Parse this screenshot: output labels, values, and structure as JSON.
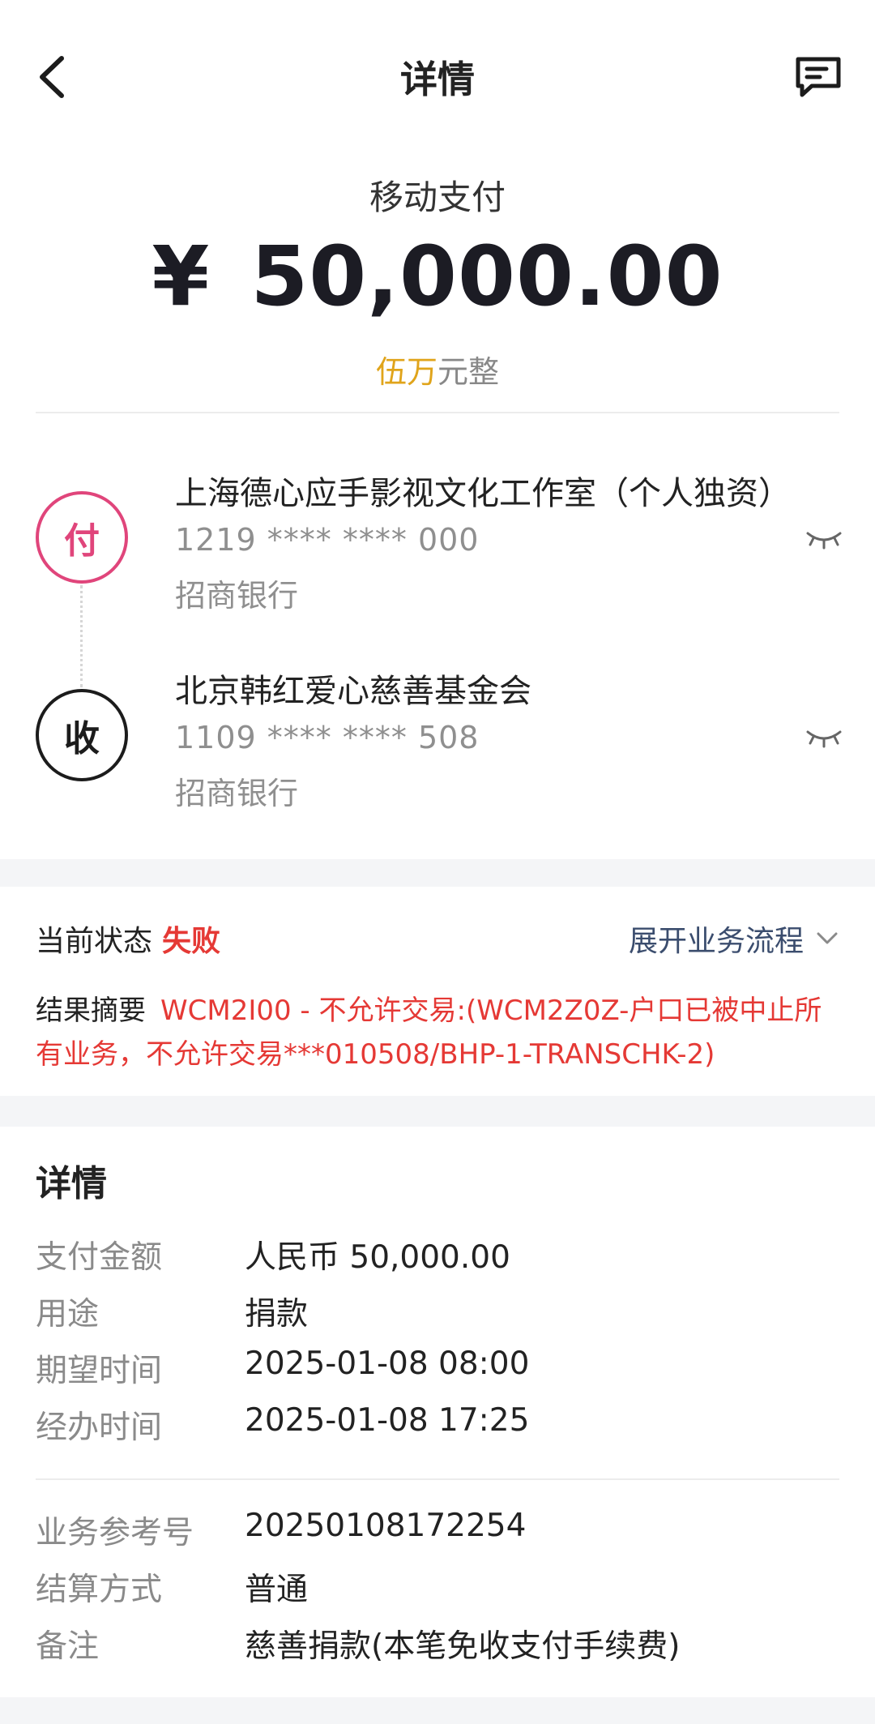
{
  "header": {
    "title": "详情",
    "back_icon": "chevron-left-icon",
    "message_icon": "message-icon"
  },
  "summary": {
    "payment_type": "移动支付",
    "currency_symbol": "¥",
    "amount": "50,000.00",
    "amount_cn_highlight": "伍万",
    "amount_cn_rest": "元整"
  },
  "payer": {
    "badge": "付",
    "name": "上海德心应手影视文化工作室（个人独资）",
    "account": "1219 **** **** 000",
    "bank": "招商银行",
    "eye_icon": "eye-closed-icon"
  },
  "payee": {
    "badge": "收",
    "name": "北京韩红爱心慈善基金会",
    "account": "1109 **** **** 508",
    "bank": "招商银行",
    "eye_icon": "eye-closed-icon"
  },
  "status": {
    "label": "当前状态",
    "value": "失败",
    "expand_label": "展开业务流程",
    "result_label": "结果摘要",
    "result_text": "WCM2I00 - 不允许交易:(WCM2Z0Z-户口已被中止所有业务，不允许交易***010508/BHP-1-TRANSCHK-2)"
  },
  "details": {
    "title": "详情",
    "rows": [
      {
        "label": "支付金额",
        "value": "人民币 50,000.00"
      },
      {
        "label": "用途",
        "value": "捐款"
      },
      {
        "label": "期望时间",
        "value": "2025-01-08 08:00"
      },
      {
        "label": "经办时间",
        "value": "2025-01-08 17:25"
      },
      {
        "label": "业务参考号",
        "value": "20250108172254"
      },
      {
        "label": "结算方式",
        "value": "普通"
      },
      {
        "label": "备注",
        "value": "慈善捐款(本笔免收支付手续费)"
      }
    ]
  },
  "colors": {
    "status_failed": "#e53935",
    "payer_accent": "#e0457b",
    "amount_highlight": "#e0a41b",
    "section_band": "#f4f5f7"
  }
}
